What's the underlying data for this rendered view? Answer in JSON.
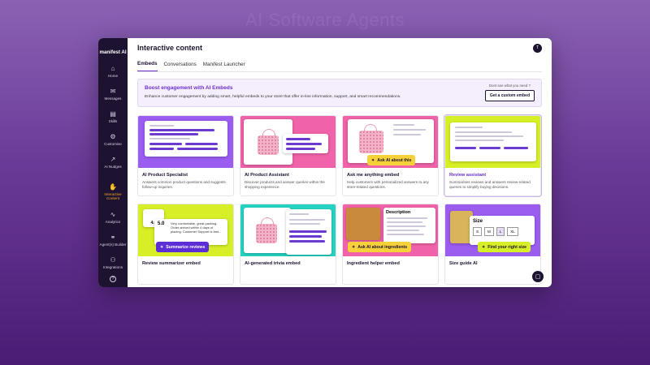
{
  "background_title": "AI Software Agents",
  "sidebar": {
    "logo": "manifest AI",
    "items": [
      {
        "label": "Home",
        "icon": "home-icon"
      },
      {
        "label": "Messages",
        "icon": "messages-icon"
      },
      {
        "label": "Skills",
        "icon": "skills-icon"
      },
      {
        "label": "Customise",
        "icon": "customise-icon"
      },
      {
        "label": "AI Nudges",
        "icon": "nudges-icon"
      },
      {
        "label": "Interactive Content",
        "icon": "interactive-content-icon"
      },
      {
        "label": "Analytics",
        "icon": "analytics-icon"
      },
      {
        "label": "Agent(s) Builder",
        "icon": "agent-builder-icon"
      }
    ],
    "bottom": {
      "integrations": "Integrations",
      "help": "?"
    }
  },
  "header": {
    "title": "Interactive content",
    "avatar": "T"
  },
  "tabs": [
    "Embeds",
    "Conversations",
    "Manifest Launcher"
  ],
  "banner": {
    "title": "Boost engagement with AI Embeds",
    "text": "Enhance customer engagement by adding smart, helpful embeds to your store that offer in-line information, support, and smart recommendations.",
    "hint": "Dont see what you need ?",
    "button": "Get a custom embed"
  },
  "cards": [
    {
      "title": "AI Product Specialist",
      "desc": "Answers common product questions and suggests follow-up inquiries."
    },
    {
      "title": "AI Product Assistant",
      "desc": "Discover products and answer queries within the shopping experience."
    },
    {
      "title": "Ask me anything embed",
      "desc": "Help customers with personalized answers to any store-related questions.",
      "pill": "Ask AI about this"
    },
    {
      "title": "Review assistant",
      "desc": "Summarises reviews and answers review-related queries to simplify buying decisions."
    },
    {
      "title": "Review summarizer embed",
      "desc": "",
      "pill": "Summarize reviews",
      "ratings": [
        "4.0",
        "5.0"
      ],
      "review_text": "Very comfortable, great packing. Order arrived within 4 days of placing. Customer Support is fant..."
    },
    {
      "title": "AI-generated trivia embed",
      "desc": ""
    },
    {
      "title": "Ingredient helper embed",
      "desc": "",
      "pill": "Ask AI about ingredients",
      "panel_title": "Description"
    },
    {
      "title": "Size guide AI",
      "desc": "",
      "pill": "Find your right size",
      "panel_title": "Size",
      "sizes": [
        "S",
        "M",
        "L",
        "XL"
      ]
    }
  ],
  "colors": {
    "accent": "#6b2fd0",
    "sidebar": "#1d1230",
    "active_nav": "#f5a524"
  }
}
